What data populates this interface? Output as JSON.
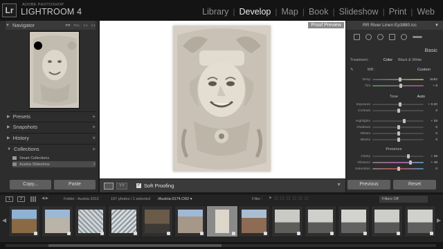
{
  "app": {
    "subtitle": "ADOBE PHOTOSHOP",
    "title": "LIGHTROOM 4",
    "badge": "Lr"
  },
  "modules": [
    {
      "label": "Library",
      "active": false
    },
    {
      "label": "Develop",
      "active": true
    },
    {
      "label": "Map",
      "active": false
    },
    {
      "label": "Book",
      "active": false
    },
    {
      "label": "Slideshow",
      "active": false
    },
    {
      "label": "Print",
      "active": false
    },
    {
      "label": "Web",
      "active": false
    }
  ],
  "left_panel": {
    "navigator": {
      "label": "Navigator",
      "zoom_options": [
        "FIT",
        "FILL",
        "1:1",
        "1:1"
      ]
    },
    "presets": "Presets",
    "snapshots": "Snapshots",
    "history": "History",
    "collections": "Collections",
    "collection_items": [
      {
        "label": "Smart Collections",
        "count": ""
      },
      {
        "label": "Austria Slideshow",
        "count": "2"
      }
    ],
    "copy_button": "Copy...",
    "paste_button": "Paste"
  },
  "center": {
    "proof_label": "Proof Preview",
    "soft_proofing_label": "Soft Proofing",
    "soft_proofing_checked": true
  },
  "right_panel": {
    "profile": "RR River Linen Ep3880.icc",
    "basic_label": "Basic",
    "treatment_label": "Treatment :",
    "treatment_color": "Color",
    "treatment_bw": "Black & White",
    "wb_label": "WB :",
    "wb_value": "Custom",
    "temp": {
      "label": "Temp",
      "value": "5192"
    },
    "tint": {
      "label": "Tint",
      "value": "+ 8"
    },
    "tone_label": "Tone",
    "auto_label": "Auto",
    "exposure": {
      "label": "Exposure",
      "value": "+ 0.20"
    },
    "contrast": {
      "label": "Contrast",
      "value": "0"
    },
    "highlights": {
      "label": "Highlights",
      "value": "+ 25"
    },
    "shadows": {
      "label": "Shadows",
      "value": "0"
    },
    "whites": {
      "label": "Whites",
      "value": "0"
    },
    "blacks": {
      "label": "Blacks",
      "value": "0"
    },
    "presence_label": "Presence",
    "clarity": {
      "label": "Clarity",
      "value": "+ 39"
    },
    "vibrance": {
      "label": "Vibrance",
      "value": "+ 48"
    },
    "saturation": {
      "label": "Saturation",
      "value": "0"
    },
    "previous_button": "Previous",
    "reset_button": "Reset"
  },
  "filmstrip_bar": {
    "screen1": "1",
    "screen2": "2",
    "folder": "Folder : Austria 2012",
    "count": "197 photos / 1 selected",
    "file": "/Austria-0174.CR2 ▾",
    "filter_label": "Filter :",
    "filter_state": "Filters Off"
  },
  "colors": {
    "panel_bg": "#2d2d2d",
    "center_bg": "#ffffff",
    "active_module": "#ececec",
    "inactive_module": "#8f8f8f"
  }
}
